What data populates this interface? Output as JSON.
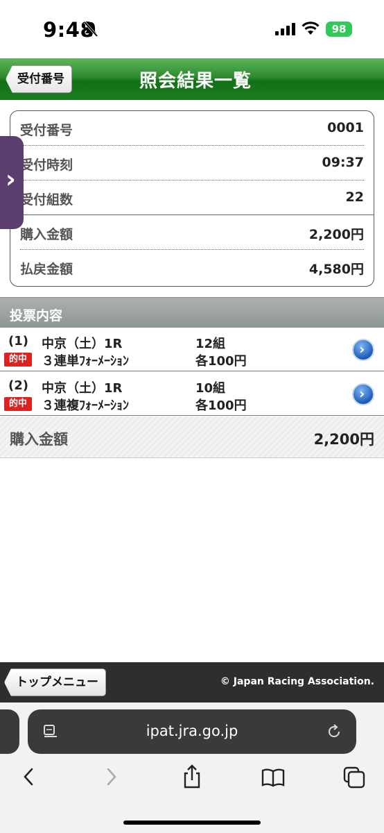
{
  "status_bar": {
    "time": "9:48",
    "battery": "98"
  },
  "header": {
    "back_label": "受付番号",
    "title": "照会結果一覧"
  },
  "receipt": [
    {
      "label": "受付番号",
      "value": "0001"
    },
    {
      "label": "受付時刻",
      "value": "09:37"
    },
    {
      "label": "受付組数",
      "value": "22"
    },
    {
      "label": "購入金額",
      "value": "2,200円"
    },
    {
      "label": "払戻金額",
      "value": "4,580円"
    }
  ],
  "bets_section": {
    "title": "投票内容"
  },
  "bets": [
    {
      "num": "(1)",
      "race": "中京（土）1R",
      "hit": "的中",
      "type": "３連単ﾌｫｰﾒｰｼｮﾝ",
      "count": "12組",
      "amount": "各100円"
    },
    {
      "num": "(2)",
      "race": "中京（土）1R",
      "hit": "的中",
      "type": "３連複ﾌｫｰﾒｰｼｮﾝ",
      "count": "10組",
      "amount": "各100円"
    }
  ],
  "total": {
    "label": "購入金額",
    "value": "2,200円"
  },
  "footer": {
    "top_menu": "トップメニュー",
    "copyright": "© Japan Racing Association."
  },
  "browser": {
    "url": "ipat.jra.go.jp"
  },
  "colors": {
    "header_green": "#1c7d20",
    "hit_red": "#dd2222",
    "battery_green": "#34c759"
  }
}
